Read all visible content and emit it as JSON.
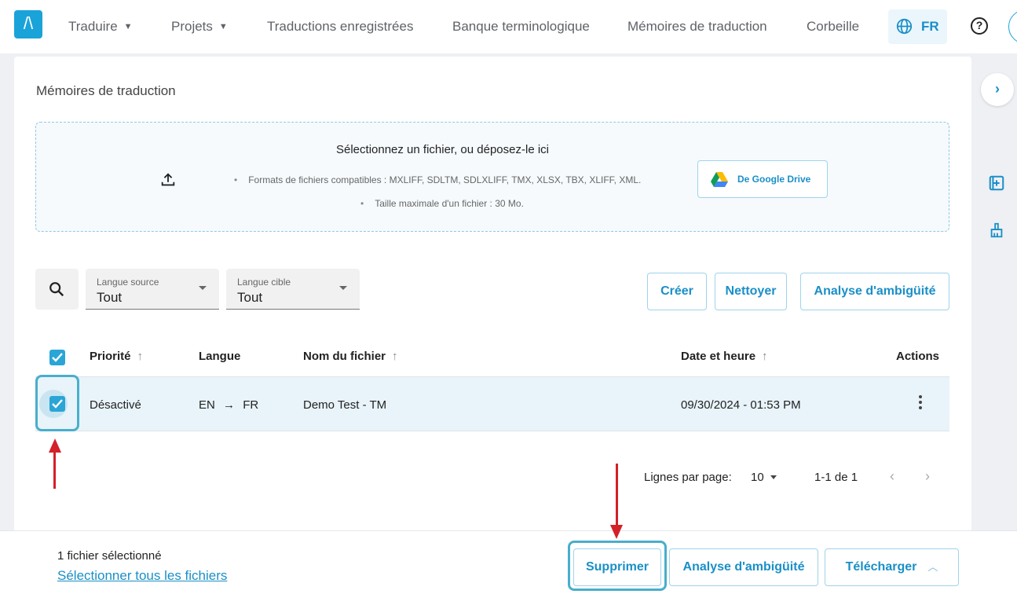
{
  "nav": {
    "logo": "/\\",
    "items": [
      "Traduire",
      "Projets",
      "Traductions enregistrées",
      "Banque terminologique",
      "Mémoires de traduction",
      "Corbeille"
    ],
    "language": "FR",
    "help": "?"
  },
  "page": {
    "title": "Mémoires de traduction"
  },
  "upload": {
    "title": "Sélectionnez un fichier, ou déposez-le ici",
    "formats": "Formats de fichiers compatibles : MXLIFF, SDLTM, SDLXLIFF, TMX, XLSX, TBX, XLIFF, XML.",
    "max_size": "Taille maximale d'un fichier : 30 Mo.",
    "gdrive_label": "De Google Drive"
  },
  "filters": {
    "source": {
      "label": "Langue source",
      "value": "Tout"
    },
    "target": {
      "label": "Langue cible",
      "value": "Tout"
    },
    "create": "Créer",
    "clean": "Nettoyer",
    "ambiguity": "Analyse d'ambigüité"
  },
  "table": {
    "headers": {
      "priority": "Priorité",
      "language": "Langue",
      "filename": "Nom du fichier",
      "datetime": "Date et heure",
      "actions": "Actions"
    },
    "rows": [
      {
        "priority": "Désactivé",
        "source": "EN",
        "arrow": "→",
        "target": "FR",
        "filename": "Demo Test - TM",
        "datetime": "09/30/2024 - 01:53 PM",
        "selected": true
      }
    ]
  },
  "pagination": {
    "rows_label": "Lignes par page:",
    "rows_value": "10",
    "range": "1-1 de 1",
    "prev": "‹",
    "next": "›"
  },
  "bottom": {
    "selected_count": "1 fichier sélectionné",
    "select_all": "Sélectionner tous les fichiers",
    "delete": "Supprimer",
    "ambiguity": "Analyse d'ambigüité",
    "download": "Télécharger"
  },
  "colors": {
    "accent": "#1a8fc7",
    "highlight": "#4aaecc",
    "annotation_arrow": "#d32029"
  }
}
